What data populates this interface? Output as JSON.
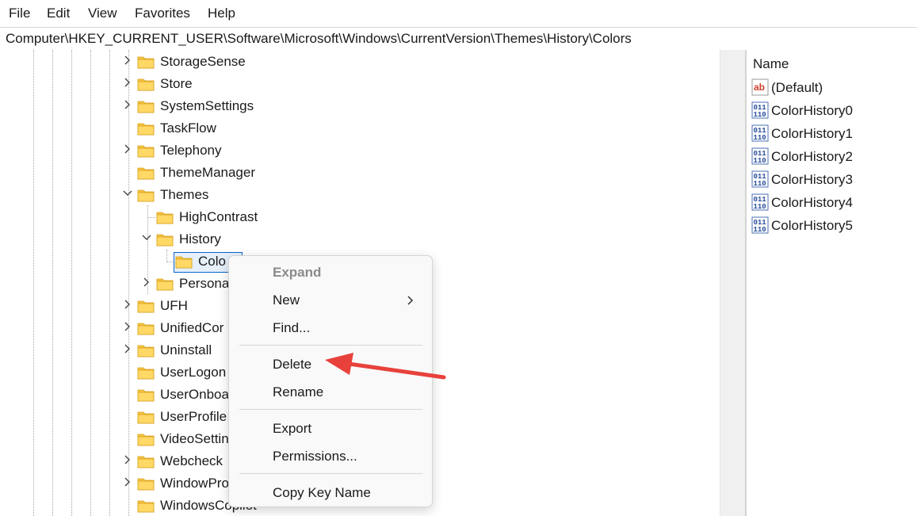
{
  "menubar": {
    "items": [
      {
        "label": "File"
      },
      {
        "label": "Edit"
      },
      {
        "label": "View"
      },
      {
        "label": "Favorites"
      },
      {
        "label": "Help"
      }
    ]
  },
  "address": {
    "path": "Computer\\HKEY_CURRENT_USER\\Software\\Microsoft\\Windows\\CurrentVersion\\Themes\\History\\Colors"
  },
  "tree": {
    "nodes": [
      {
        "label": "StorageSense",
        "expander": "collapsed"
      },
      {
        "label": "Store",
        "expander": "collapsed"
      },
      {
        "label": "SystemSettings",
        "expander": "collapsed"
      },
      {
        "label": "TaskFlow",
        "expander": "none"
      },
      {
        "label": "Telephony",
        "expander": "collapsed"
      },
      {
        "label": "ThemeManager",
        "expander": "none"
      },
      {
        "label": "Themes",
        "expander": "expanded"
      },
      {
        "label": "HighContrast",
        "expander": "none"
      },
      {
        "label": "History",
        "expander": "expanded"
      },
      {
        "label": "Colo",
        "expander": "none",
        "selected": true
      },
      {
        "label": "Persona",
        "expander": "collapsed"
      },
      {
        "label": "UFH",
        "expander": "collapsed"
      },
      {
        "label": "UnifiedCor",
        "expander": "collapsed"
      },
      {
        "label": "Uninstall",
        "expander": "collapsed"
      },
      {
        "label": "UserLogon",
        "expander": "none"
      },
      {
        "label": "UserOnboa",
        "expander": "none"
      },
      {
        "label": "UserProfile",
        "expander": "none"
      },
      {
        "label": "VideoSettin",
        "expander": "none"
      },
      {
        "label": "Webcheck",
        "expander": "collapsed"
      },
      {
        "label": "WindowPro",
        "expander": "collapsed"
      },
      {
        "label": "WindowsCopilot",
        "expander": "none"
      }
    ]
  },
  "values_pane": {
    "column_header": "Name",
    "rows": [
      {
        "name": "(Default)",
        "icon": "string-value-icon"
      },
      {
        "name": "ColorHistory0",
        "icon": "binary-value-icon"
      },
      {
        "name": "ColorHistory1",
        "icon": "binary-value-icon"
      },
      {
        "name": "ColorHistory2",
        "icon": "binary-value-icon"
      },
      {
        "name": "ColorHistory3",
        "icon": "binary-value-icon"
      },
      {
        "name": "ColorHistory4",
        "icon": "binary-value-icon"
      },
      {
        "name": "ColorHistory5",
        "icon": "binary-value-icon"
      }
    ]
  },
  "context_menu": {
    "items": [
      {
        "label": "Expand",
        "disabled": true
      },
      {
        "label": "New",
        "submenu": true
      },
      {
        "label": "Find..."
      },
      {
        "label": "Delete"
      },
      {
        "label": "Rename"
      },
      {
        "label": "Export"
      },
      {
        "label": "Permissions..."
      },
      {
        "label": "Copy Key Name"
      }
    ]
  },
  "colors": {
    "folder": "#f5c242",
    "selection_border": "#0a64c8",
    "arrow": "#e8413b",
    "disabled_text": "#8a8a8a"
  }
}
